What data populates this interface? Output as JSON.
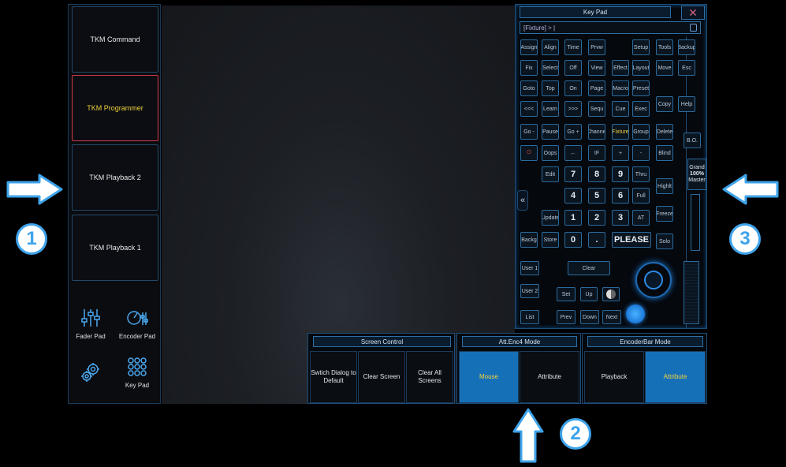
{
  "left_panel": {
    "buttons": [
      {
        "label": "TKM Command"
      },
      {
        "label": "TKM Programmer",
        "active": true
      },
      {
        "label": "TKM Playback 2"
      },
      {
        "label": "TKM Playback 1"
      }
    ],
    "icons": [
      {
        "label": "Fader Pad",
        "icon": "fader-icon"
      },
      {
        "label": "Encoder Pad",
        "icon": "encoder-icon"
      },
      {
        "label": "",
        "icon": "gear-icon"
      },
      {
        "label": "Key Pad",
        "icon": "keypad-icon"
      }
    ]
  },
  "keypad": {
    "title": "Key Pad",
    "close": "✕",
    "command_line": "[Fixture] > |",
    "rows": [
      [
        "Assign",
        "Align",
        "Time",
        "Prvw",
        "",
        "Setup",
        "Tools",
        "Backup"
      ],
      [
        "Fix",
        "Select",
        "Off",
        "View",
        "Effect",
        "Layout",
        "Move",
        "Esc"
      ],
      [
        "Goto",
        "Top",
        "On",
        "Page",
        "Macro",
        "Preset",
        "Copy",
        "Help"
      ],
      [
        "<<<",
        "Learn",
        ">>>",
        "Sequ",
        "Cue",
        "Exec",
        "",
        ""
      ],
      [
        "Go -",
        "Pause",
        "Go +",
        "Channel",
        "Fixture",
        "Group",
        "Delete",
        "B.O."
      ],
      [
        "⏻",
        "Oops",
        "←",
        "IF",
        "+",
        "-",
        "Blind",
        ""
      ],
      [
        "",
        "Edit",
        "7",
        "8",
        "9",
        "Thru",
        "Highlt",
        ""
      ],
      [
        "",
        "",
        "4",
        "5",
        "6",
        "Full",
        "",
        ""
      ],
      [
        "",
        "Update",
        "1",
        "2",
        "3",
        "AT",
        "Freeze",
        ""
      ],
      [
        "Backg",
        "Store",
        "0",
        ".",
        "PLEASE",
        "",
        "Solo",
        ""
      ]
    ],
    "extra": {
      "user1": "User 1",
      "clear": "Clear",
      "user2": "User 2",
      "set": "Set",
      "up": "Up",
      "list": "List",
      "prev": "Prev",
      "down": "Down",
      "next": "Next",
      "grand_line1": "Grand",
      "grand_line2": "100%",
      "grand_line3": "Master",
      "collapse": "«"
    }
  },
  "bottom_panels": [
    {
      "title": "Screen Control",
      "buttons": [
        "Swtich Dialog to Default",
        "Clear Screen",
        "Clear All Screens"
      ]
    },
    {
      "title": "Att.Enc4 Mode",
      "buttons": [
        "Mouse",
        "Attribute"
      ],
      "selected": 0
    },
    {
      "title": "EncoderBar Mode",
      "buttons": [
        "Playback",
        "Attribute"
      ],
      "selected": 1
    }
  ],
  "annotations": [
    {
      "number": "1",
      "arrow": "right"
    },
    {
      "number": "2",
      "arrow": "up"
    },
    {
      "number": "3",
      "arrow": "left"
    }
  ],
  "colors": {
    "accent": "#3ea3ea",
    "active_border": "#d23a4a",
    "active_text": "#f0d23a",
    "selected_bg": "#1670b8"
  }
}
